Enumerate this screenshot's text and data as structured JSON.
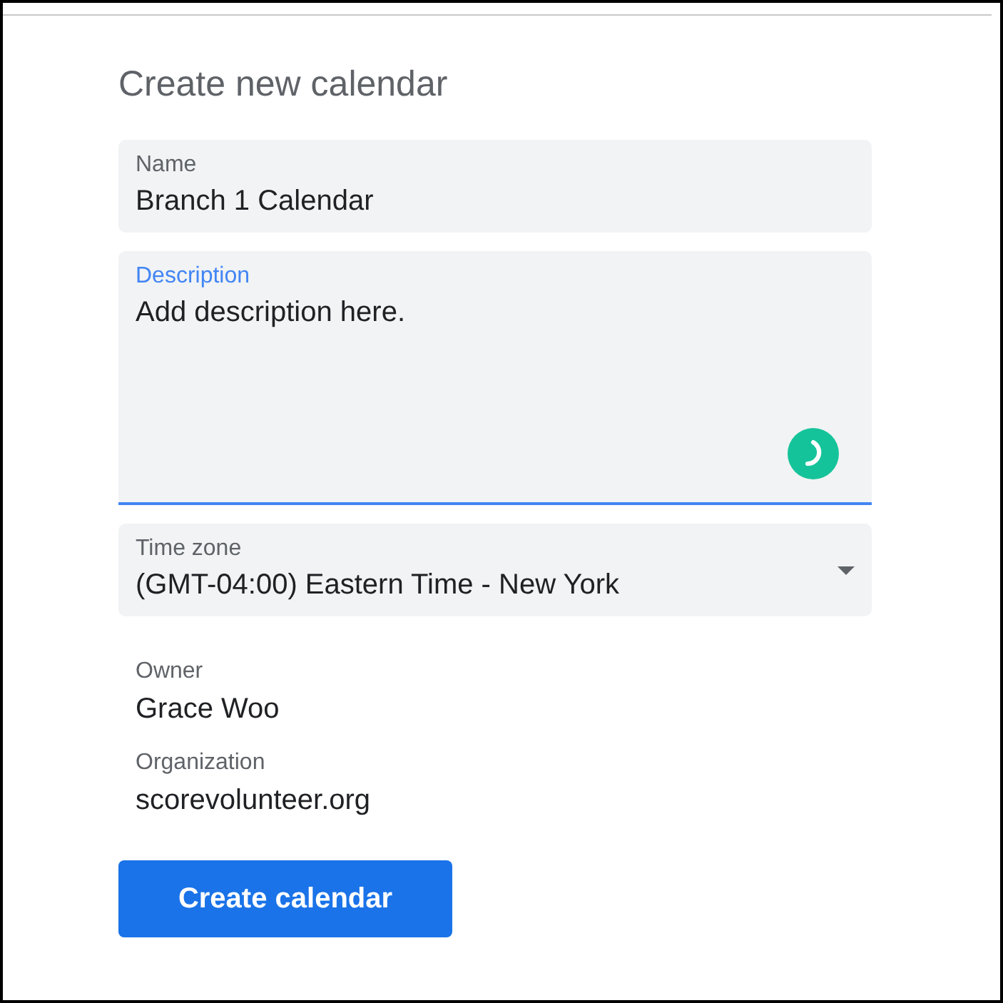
{
  "title": "Create new calendar",
  "fields": [
    {
      "kind": "text",
      "label": "Name",
      "value": "Branch 1 Calendar",
      "focused": false
    },
    {
      "kind": "textarea",
      "label": "Description",
      "value": "Add description here.",
      "focused": true
    },
    {
      "kind": "select",
      "label": "Time zone",
      "value": "(GMT-04:00) Eastern Time - New York",
      "focused": false
    }
  ],
  "info": [
    {
      "label": "Owner",
      "value": "Grace Woo"
    },
    {
      "label": "Organization",
      "value": "scorevolunteer.org"
    }
  ],
  "button": "Create calendar"
}
